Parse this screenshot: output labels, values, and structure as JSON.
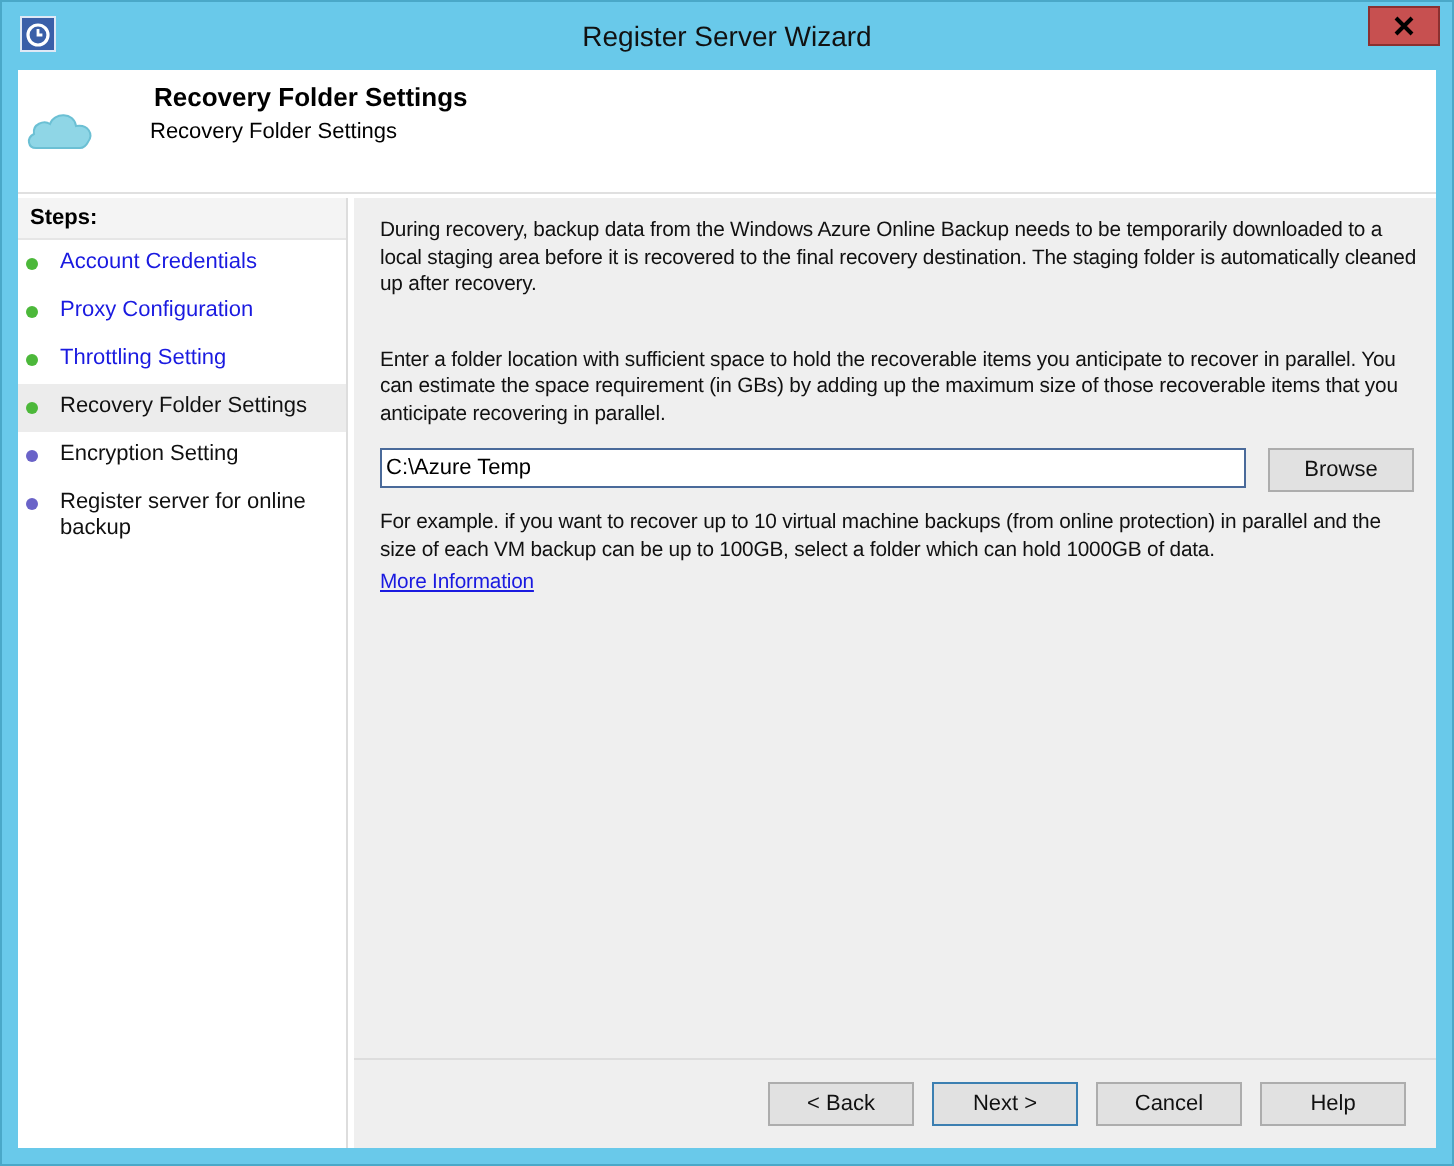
{
  "window": {
    "title": "Register Server Wizard"
  },
  "header": {
    "title": "Recovery Folder Settings",
    "subtitle": "Recovery Folder Settings"
  },
  "steps": {
    "heading": "Steps:",
    "items": [
      {
        "label": "Account Credentials",
        "color": "#4cb83a",
        "selected": false
      },
      {
        "label": "Proxy Configuration",
        "color": "#4cb83a",
        "selected": false
      },
      {
        "label": "Throttling Setting",
        "color": "#4cb83a",
        "selected": false
      },
      {
        "label": "Recovery Folder Settings",
        "color": "#4cb83a",
        "selected": true
      },
      {
        "label": "Encryption Setting",
        "color": "#6a63c8",
        "selected": false
      },
      {
        "label": "Register server for online backup",
        "color": "#6a63c8",
        "selected": false
      }
    ]
  },
  "content": {
    "intro": "During recovery, backup data from the Windows Azure Online Backup needs to be temporarily downloaded to a local staging area before it is recovered to the final recovery destination. The staging folder is automatically cleaned up after recovery.",
    "instruction": "Enter a folder location with sufficient space to hold the recoverable items you anticipate to recover in parallel. You can estimate the space requirement (in GBs) by adding up the maximum size of those recoverable items that you anticipate recovering in parallel.",
    "folder_field": {
      "value": "C:\\Azure Temp"
    },
    "browse_button": "Browse",
    "example": "For example. if you want to recover up to 10 virtual machine backups (from online protection) in parallel and the size of each VM backup can be up to 100GB, select a folder which can hold 1000GB of data.",
    "link": "More Information"
  },
  "buttons": [
    {
      "label": "< Back",
      "default": false
    },
    {
      "label": "Next >",
      "default": true
    },
    {
      "label": "Cancel",
      "default": false
    },
    {
      "label": "Help",
      "default": false
    }
  ]
}
